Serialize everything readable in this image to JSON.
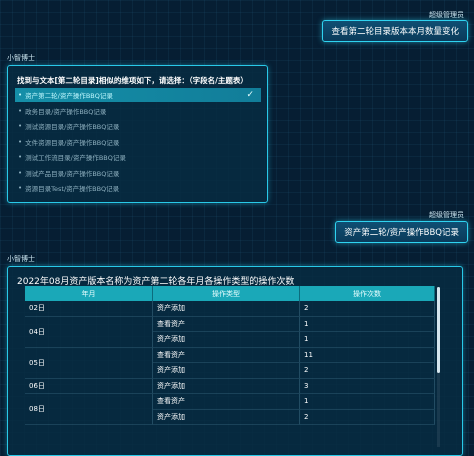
{
  "messages": {
    "user1": {
      "name": "超级管理员",
      "text": "查看第二轮目录版本本月数量变化"
    },
    "bot1": {
      "name": "小智博士",
      "prompt": "找到与文本[第二轮目录]相似的维项如下，请选择：（字段名/主题表）",
      "options": [
        "资产第二轮/资产操作BBQ记录",
        "政务目录/资产操作BBQ记录",
        "测试资源目录/资产操作BBQ记录",
        "文件资源目录/资产操作BBQ记录",
        "测试工作流目录/资产操作BBQ记录",
        "测试产品目录/资产操作BBQ记录",
        "资源目录Test/资产操作BBQ记录"
      ],
      "selected_index": 0
    },
    "user2": {
      "name": "超级管理员",
      "text": "资产第二轮/资产操作BBQ记录"
    },
    "bot2": {
      "name": "小智博士",
      "table_title": "2022年08月资产版本名称为资产第二轮各年月各操作类型的操作次数",
      "columns": [
        "年月",
        "操作类型",
        "操作次数"
      ],
      "groups": [
        {
          "month": "02日",
          "rows": [
            {
              "type": "资产添加",
              "count": "2"
            }
          ]
        },
        {
          "month": "04日",
          "rows": [
            {
              "type": "查看资产",
              "count": "1"
            },
            {
              "type": "资产添加",
              "count": "1"
            }
          ]
        },
        {
          "month": "05日",
          "rows": [
            {
              "type": "查看资产",
              "count": "11"
            },
            {
              "type": "资产添加",
              "count": "2"
            }
          ]
        },
        {
          "month": "06日",
          "rows": [
            {
              "type": "资产添加",
              "count": "3"
            }
          ]
        },
        {
          "month": "08日",
          "rows": [
            {
              "type": "查看资产",
              "count": "1"
            },
            {
              "type": "资产添加",
              "count": "2"
            }
          ]
        }
      ]
    }
  },
  "icons": {
    "check": "check-icon"
  },
  "colors": {
    "accent": "#29c9e8",
    "header": "#1aa8b8",
    "selected": "#158fa8",
    "background": "#061e33"
  }
}
